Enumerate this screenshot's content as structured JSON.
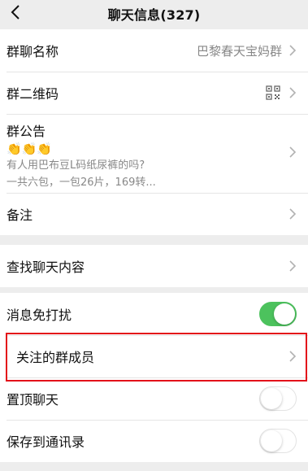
{
  "nav": {
    "title": "聊天信息(327)",
    "back_icon": "chevron-left-icon"
  },
  "group_info": {
    "name_label": "群聊名称",
    "name_value": "巴黎春天宝妈群",
    "qr_label": "群二维码",
    "qr_icon": "qr-code-icon",
    "announcement_label": "群公告",
    "announcement_emoji": "👏👏👏",
    "announcement_line1": "有人用巴布豆L码纸尿裤的吗?",
    "announcement_line2": "一共六包，一包26片，169转...",
    "remark_label": "备注"
  },
  "search": {
    "label": "查找聊天内容"
  },
  "settings": {
    "mute_label": "消息免打扰",
    "mute_on": true,
    "followed_members_label": "关注的群成员",
    "pin_label": "置顶聊天",
    "pin_on": false,
    "save_contacts_label": "保存到通讯录",
    "save_contacts_on": false
  },
  "colors": {
    "switch_on": "#4cc25d",
    "highlight": "#e3111a",
    "background": "#ededed"
  }
}
